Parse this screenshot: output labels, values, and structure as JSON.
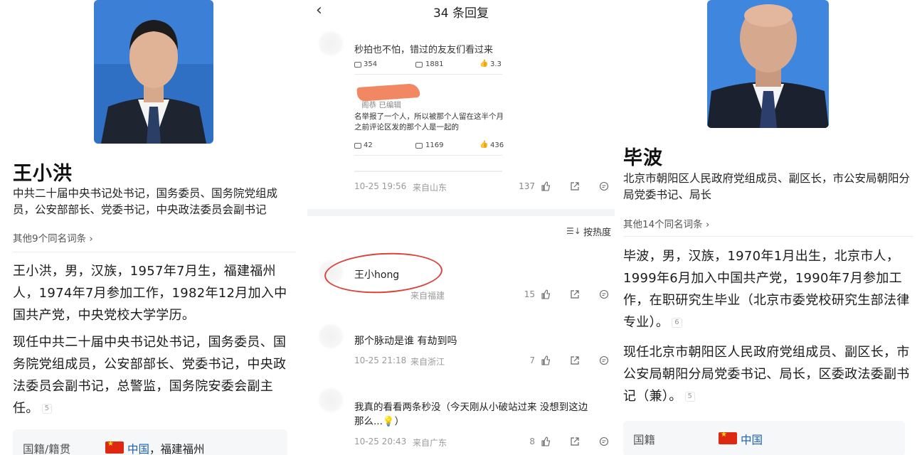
{
  "left": {
    "name": "王小洪",
    "title": "中共二十届中央书记处书记，国务委员、国务院党组成员，公安部部长、党委书记，中央政法委员会副书记",
    "more": "其他9个同名词条 ›",
    "para1": "王小洪，男，汉族，1957年7月生，福建福州人，1974年7月参加工作，1982年12月加入中国共产党，中央党校大学学历。",
    "para2": "现任中共二十届中央书记处书记，国务委员、国务院党组成员，公安部部长、党委书记，中央政法委员会副书记，总警监，国务院安委会副主任。",
    "para2_ref": "5",
    "info_label": "国籍/籍贯",
    "info_country": "中国",
    "info_place": "，福建福州"
  },
  "middle": {
    "back_icon": "chevron-left-icon",
    "header_title": "34 条回复",
    "snippet1": "秒拍也不怕，错过的友友们看过来",
    "stats1": [
      "354",
      "1881",
      "3.3"
    ],
    "snippet_name": "阁恭  已编辑",
    "snippet2_line1": "名举报了一个人，所以被那个人留在这半个月",
    "snippet2_line2": "之前评论区发的那个人是一起的",
    "stats2": [
      "42",
      "1169",
      "436"
    ],
    "comment0": {
      "time": "10-25 19:56",
      "location": "来自山东",
      "likes": "137"
    },
    "sort_label": "按热度",
    "comment1": {
      "text": "王小hong",
      "location": "来自福建",
      "likes": "15"
    },
    "comment2": {
      "text": "那个脉动是谁 有劫到吗",
      "time": "10-25 21:18",
      "location": "来自浙江",
      "likes": "7"
    },
    "comment3": {
      "text1": "我真的看看两条秒没（今天刚从小破站过来 没想到这边",
      "text2": "那么...💡）",
      "time": "10-25 20:43",
      "location": "来自广东",
      "likes": "8"
    }
  },
  "right": {
    "name": "毕波",
    "title": "北京市朝阳区人民政府党组成员、副区长，市公安局朝阳分局党委书记、局长",
    "more": "其他14个同名词条 ›",
    "para1": "毕波，男，汉族，1970年1月出生，北京市人，1999年6月加入中国共产党，1990年7月参加工作，在职研究生毕业（北京市委党校研究生部法律专业）。",
    "para1_ref": "6",
    "para2": "现任北京市朝阳区人民政府党组成员、副区长，市公安局朝阳分局党委书记、局长，区委政法委副书记（兼）。",
    "para2_ref": "5",
    "info_label": "国籍",
    "info_country": "中国"
  },
  "colors": {
    "link": "#1a5fb4",
    "accent_orange": "#e27b29",
    "mark_red": "#d9453b"
  }
}
